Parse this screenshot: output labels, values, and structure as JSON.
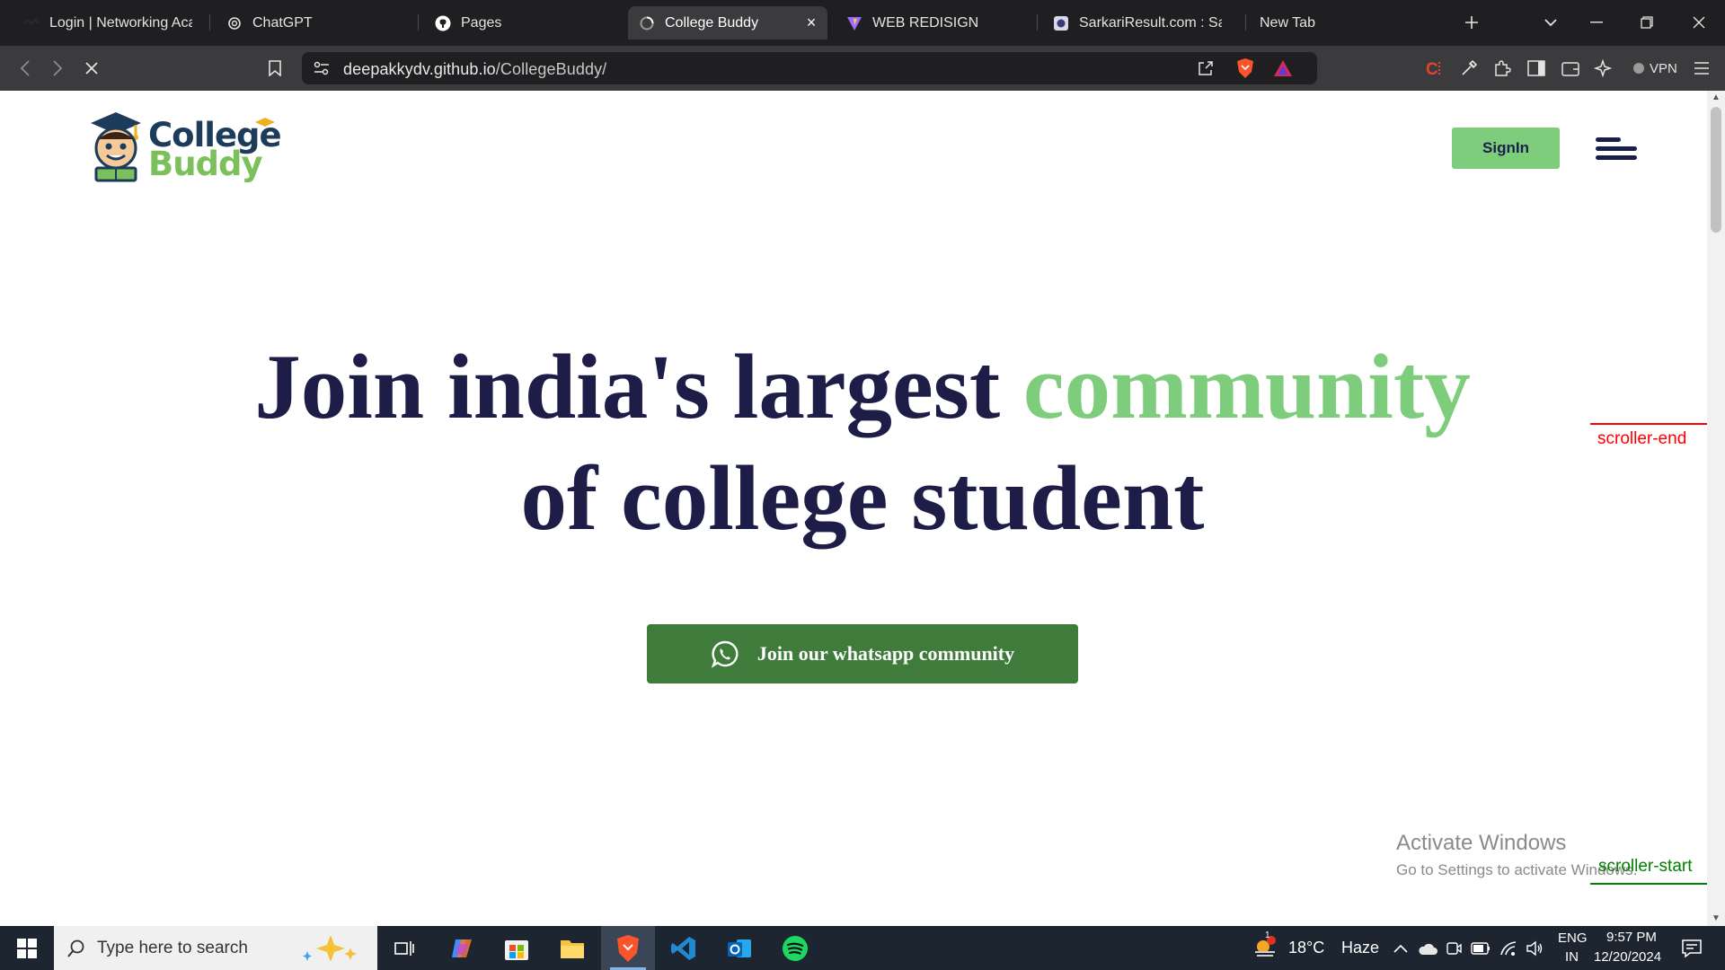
{
  "browser": {
    "tabs": [
      {
        "title": "Login | Networking Acade",
        "icon": "netacad-icon"
      },
      {
        "title": "ChatGPT",
        "icon": "chatgpt-icon"
      },
      {
        "title": "Pages",
        "icon": "github-icon"
      },
      {
        "title": "College Buddy",
        "icon": "loading-spinner-icon",
        "active": true
      },
      {
        "title": "WEB REDISIGN",
        "icon": "vite-icon"
      },
      {
        "title": "SarkariResult.com : Sarkar",
        "icon": "sarkari-icon"
      },
      {
        "title": "New Tab",
        "icon": ""
      }
    ],
    "url_host": "deepakkydv.github.io",
    "url_path": "/CollegeBuddy/",
    "vpn_label": "VPN"
  },
  "page": {
    "logo": {
      "line1": "College",
      "line2": "Buddy"
    },
    "signin_label": "SignIn",
    "hero": {
      "line1_main": "Join india's largest ",
      "line1_accent": "community",
      "line2": "of college student"
    },
    "whatsapp_button_label": "Join our whatsapp community",
    "scroller_end": "scroller-end",
    "scroller_start": "scroller-start",
    "activate_title": "Activate Windows",
    "activate_sub": "Go to Settings to activate Windows.",
    "colors": {
      "navy": "#1d1d48",
      "accent_green": "#7dcd7c",
      "whatsapp_green": "#3f7c3c"
    }
  },
  "taskbar": {
    "search_placeholder": "Type here to search",
    "weather_temp": "18°C",
    "weather_text": "Haze",
    "weather_badge": "1",
    "lang_line1": "ENG",
    "lang_line2": "IN",
    "time": "9:57 PM",
    "date": "12/20/2024"
  }
}
